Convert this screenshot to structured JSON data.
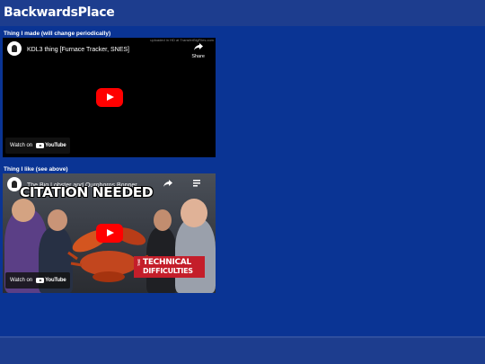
{
  "site": {
    "title": "BackwardsPlace"
  },
  "sections": [
    {
      "label": "Thing I made (will change periodically)",
      "video": {
        "title": "KDL3 thing [Furnace Tracker, SNES]",
        "uploaded_note": "uploaded in HD at TransferBigFiles.com",
        "share_label": "Share",
        "watch_on": "Watch on",
        "logo_text": "YouTube"
      }
    },
    {
      "label": "Thing I like (see above)",
      "video": {
        "title": "The Big Lobster and Ouroboros Bopper",
        "thumbnail_headline": "CITATION NEEDED",
        "badge_the": "THE",
        "badge_line1": "TECHNICAL",
        "badge_line2": "DIFFICULTIES",
        "watch_on": "Watch on",
        "logo_text": "YouTube"
      }
    }
  ],
  "colors": {
    "page_background": "#0a3494",
    "header_background": "#1d3d8e",
    "play_button": "#ff0000",
    "badge_red": "#c41e2a"
  }
}
